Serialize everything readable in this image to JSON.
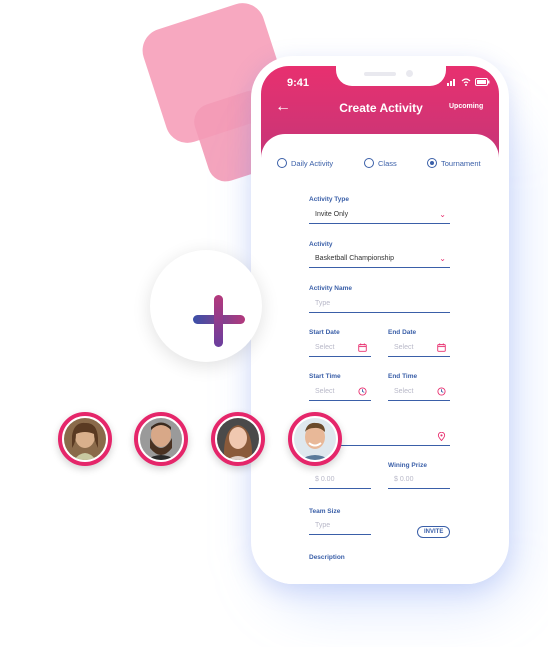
{
  "status_bar": {
    "time": "9:41"
  },
  "header": {
    "title": "Create Activity",
    "right_link": "Upcoming"
  },
  "activity_types": [
    {
      "label": "Daily Activity",
      "selected": false
    },
    {
      "label": "Class",
      "selected": false
    },
    {
      "label": "Tournament",
      "selected": true
    }
  ],
  "form": {
    "activity_type": {
      "label": "Activity Type",
      "value": "Invite Only"
    },
    "activity": {
      "label": "Activity",
      "value": "Basketball Championship"
    },
    "activity_name": {
      "label": "Activity Name",
      "placeholder": "Type"
    },
    "start_date": {
      "label": "Start Date",
      "placeholder": "Select"
    },
    "end_date": {
      "label": "End Date",
      "placeholder": "Select"
    },
    "start_time": {
      "label": "Start Time",
      "placeholder": "Select"
    },
    "end_time": {
      "label": "End Time",
      "placeholder": "Select"
    },
    "entry_fee": {
      "placeholder": "$  0.00"
    },
    "wining_prize": {
      "label": "Wining Prize",
      "placeholder": "$  0.00"
    },
    "team_size": {
      "label": "Team Size",
      "placeholder": "Type"
    },
    "invite_button": "INVITE",
    "description": {
      "label": "Description"
    }
  },
  "colors": {
    "primary": "#e8306f",
    "header_end": "#b4397c",
    "accent_blue": "#3a5fa8",
    "deco_pink": "#f7a3bd"
  },
  "icons": [
    "back-arrow-icon",
    "signal-icon",
    "wifi-icon",
    "battery-icon",
    "chevron-down-icon",
    "calendar-icon",
    "clock-icon",
    "location-pin-icon",
    "plus-icon"
  ],
  "avatars": [
    "participant-1",
    "participant-2",
    "participant-3",
    "participant-4"
  ]
}
